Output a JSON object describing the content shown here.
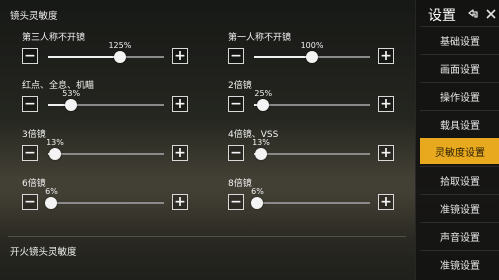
{
  "sidebar": {
    "title": "设置",
    "items": [
      {
        "label": "基础设置",
        "active": false
      },
      {
        "label": "画面设置",
        "active": false
      },
      {
        "label": "操作设置",
        "active": false
      },
      {
        "label": "载具设置",
        "active": false
      },
      {
        "label": "灵敏度设置",
        "active": true
      },
      {
        "label": "拾取设置",
        "active": false
      },
      {
        "label": "准镜设置",
        "active": false
      },
      {
        "label": "声音设置",
        "active": false
      },
      {
        "label": "准镜设置",
        "active": false
      }
    ]
  },
  "section1": {
    "title": "镜头灵敏度"
  },
  "section2": {
    "title": "开火镜头灵敏度"
  },
  "settings": [
    {
      "label": "第三人称不开镜",
      "value_text": "125%",
      "fraction": 0.62
    },
    {
      "label": "第一人称不开镜",
      "value_text": "100%",
      "fraction": 0.5
    },
    {
      "label": "红点、全息、机瞄",
      "value_text": "53%",
      "fraction": 0.2
    },
    {
      "label": "2倍镜",
      "value_text": "25%",
      "fraction": 0.08
    },
    {
      "label": "3倍镜",
      "value_text": "13%",
      "fraction": 0.06
    },
    {
      "label": "4倍镜、VSS",
      "value_text": "13%",
      "fraction": 0.06
    },
    {
      "label": "6倍镜",
      "value_text": "6%",
      "fraction": 0.03
    },
    {
      "label": "8倍镜",
      "value_text": "6%",
      "fraction": 0.03
    }
  ],
  "controls": {
    "minus": "−",
    "plus": "+"
  },
  "colors": {
    "accent": "#e8a91f"
  },
  "icons": {
    "back": "back-arrow-icon",
    "close": "close-icon"
  }
}
